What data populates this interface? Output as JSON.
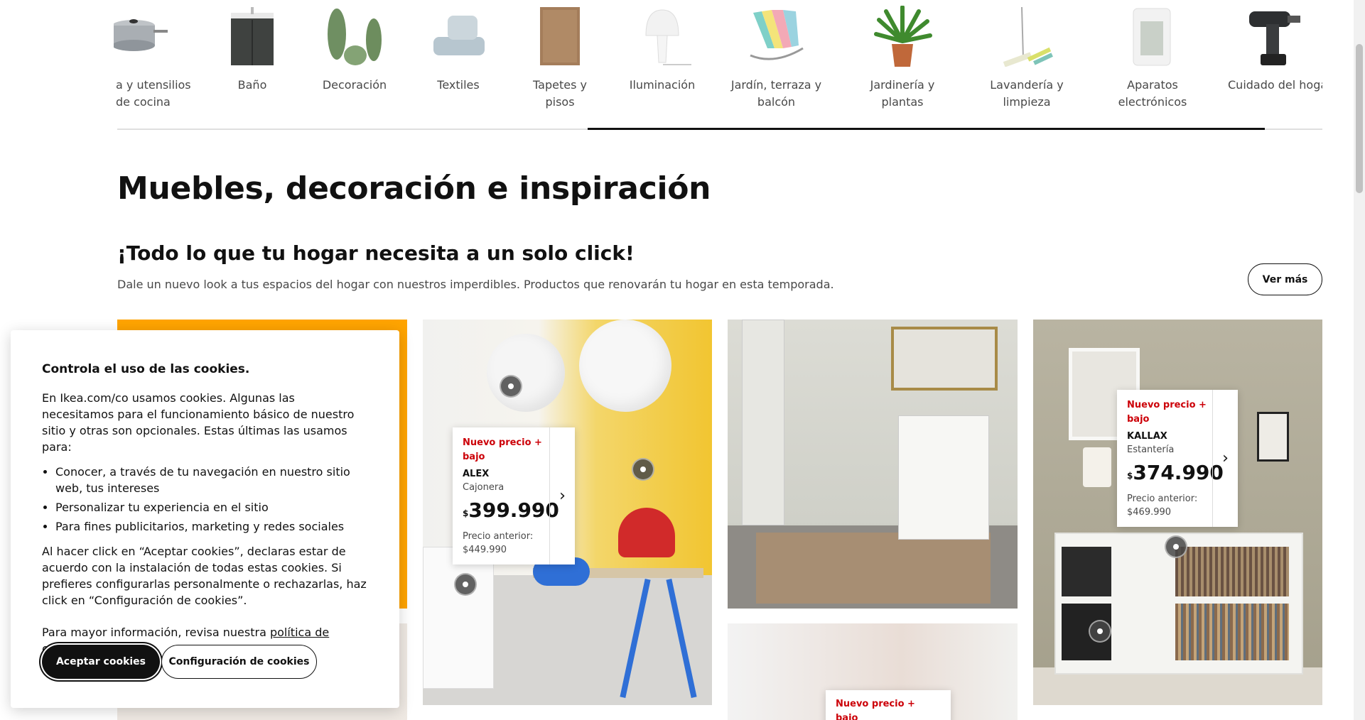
{
  "categories": [
    {
      "label_line1": "a y utensilios",
      "label_line2": "de cocina",
      "icon": "pot-icon"
    },
    {
      "label_line1": "Baño",
      "label_line2": "",
      "icon": "bathroom-cabinet-icon"
    },
    {
      "label_line1": "Decoración",
      "label_line2": "",
      "icon": "cactus-decor-icon"
    },
    {
      "label_line1": "Textiles",
      "label_line2": "",
      "icon": "bedding-icon"
    },
    {
      "label_line1": "Tapetes y pisos",
      "label_line2": "",
      "icon": "rug-icon"
    },
    {
      "label_line1": "Iluminación",
      "label_line2": "",
      "icon": "lamp-icon"
    },
    {
      "label_line1": "Jardín, terraza y",
      "label_line2": "balcón",
      "icon": "beach-chair-icon"
    },
    {
      "label_line1": "Jardinería y plantas",
      "label_line2": "",
      "icon": "potted-plant-icon"
    },
    {
      "label_line1": "Lavandería y",
      "label_line2": "limpieza",
      "icon": "mop-icon"
    },
    {
      "label_line1": "Aparatos",
      "label_line2": "electrónicos",
      "icon": "smart-device-icon"
    },
    {
      "label_line1": "Cuidado del hogar",
      "label_line2": "",
      "icon": "drill-icon"
    }
  ],
  "page_title": "Muebles, decoración e inspiración",
  "section": {
    "title": "¡Todo lo que tu hogar necesita a un solo click!",
    "subtitle": "Dale un nuevo look a tus espacios del hogar con nuestros imperdibles. Productos que renovarán tu hogar en esta temporada.",
    "see_more": "Ver más"
  },
  "products": [
    {
      "badge_l1": "Nuevo precio +",
      "badge_l2": "bajo",
      "name": "ALEX",
      "type": "Cajonera",
      "currency": "$",
      "price": "399.990",
      "prev_label": "Precio anterior:",
      "prev_price": "$449.990"
    },
    {
      "badge_l1": "Nuevo precio +",
      "badge_l2": "bajo",
      "name": "KALLAX",
      "type": "Estantería",
      "currency": "$",
      "price": "374.990",
      "prev_label": "Precio anterior:",
      "prev_price": "$469.990"
    },
    {
      "badge_l1": "Nuevo precio +",
      "badge_l2": "bajo"
    }
  ],
  "cookie": {
    "title": "Controla el uso de las cookies.",
    "intro": "En Ikea.com/co usamos cookies. Algunas las necesitamos para el funcionamiento básico de nuestro sitio y otras son opcionales. Estas últimas las usamos para:",
    "bullets": [
      "Conocer, a través de tu navegación en nuestro sitio web, tus intereses",
      "Personalizar tu experiencia en el sitio",
      "Para fines publicitarios, marketing y redes sociales"
    ],
    "consent": "Al hacer click en “Aceptar cookies”, declaras estar de acuerdo con la instalación de todas estas cookies. Si prefieres configurarlas personalmente o rechazarlas, haz click en “Configuración de cookies”.",
    "more_info": "Para mayor información, revisa nuestra ",
    "policy_link": "política de cookies.",
    "accept": "Aceptar cookies",
    "config": "Configuración de cookies"
  },
  "colors": {
    "brand_yellow": "#ffa400",
    "price_red": "#cc0008",
    "text": "#111111"
  }
}
